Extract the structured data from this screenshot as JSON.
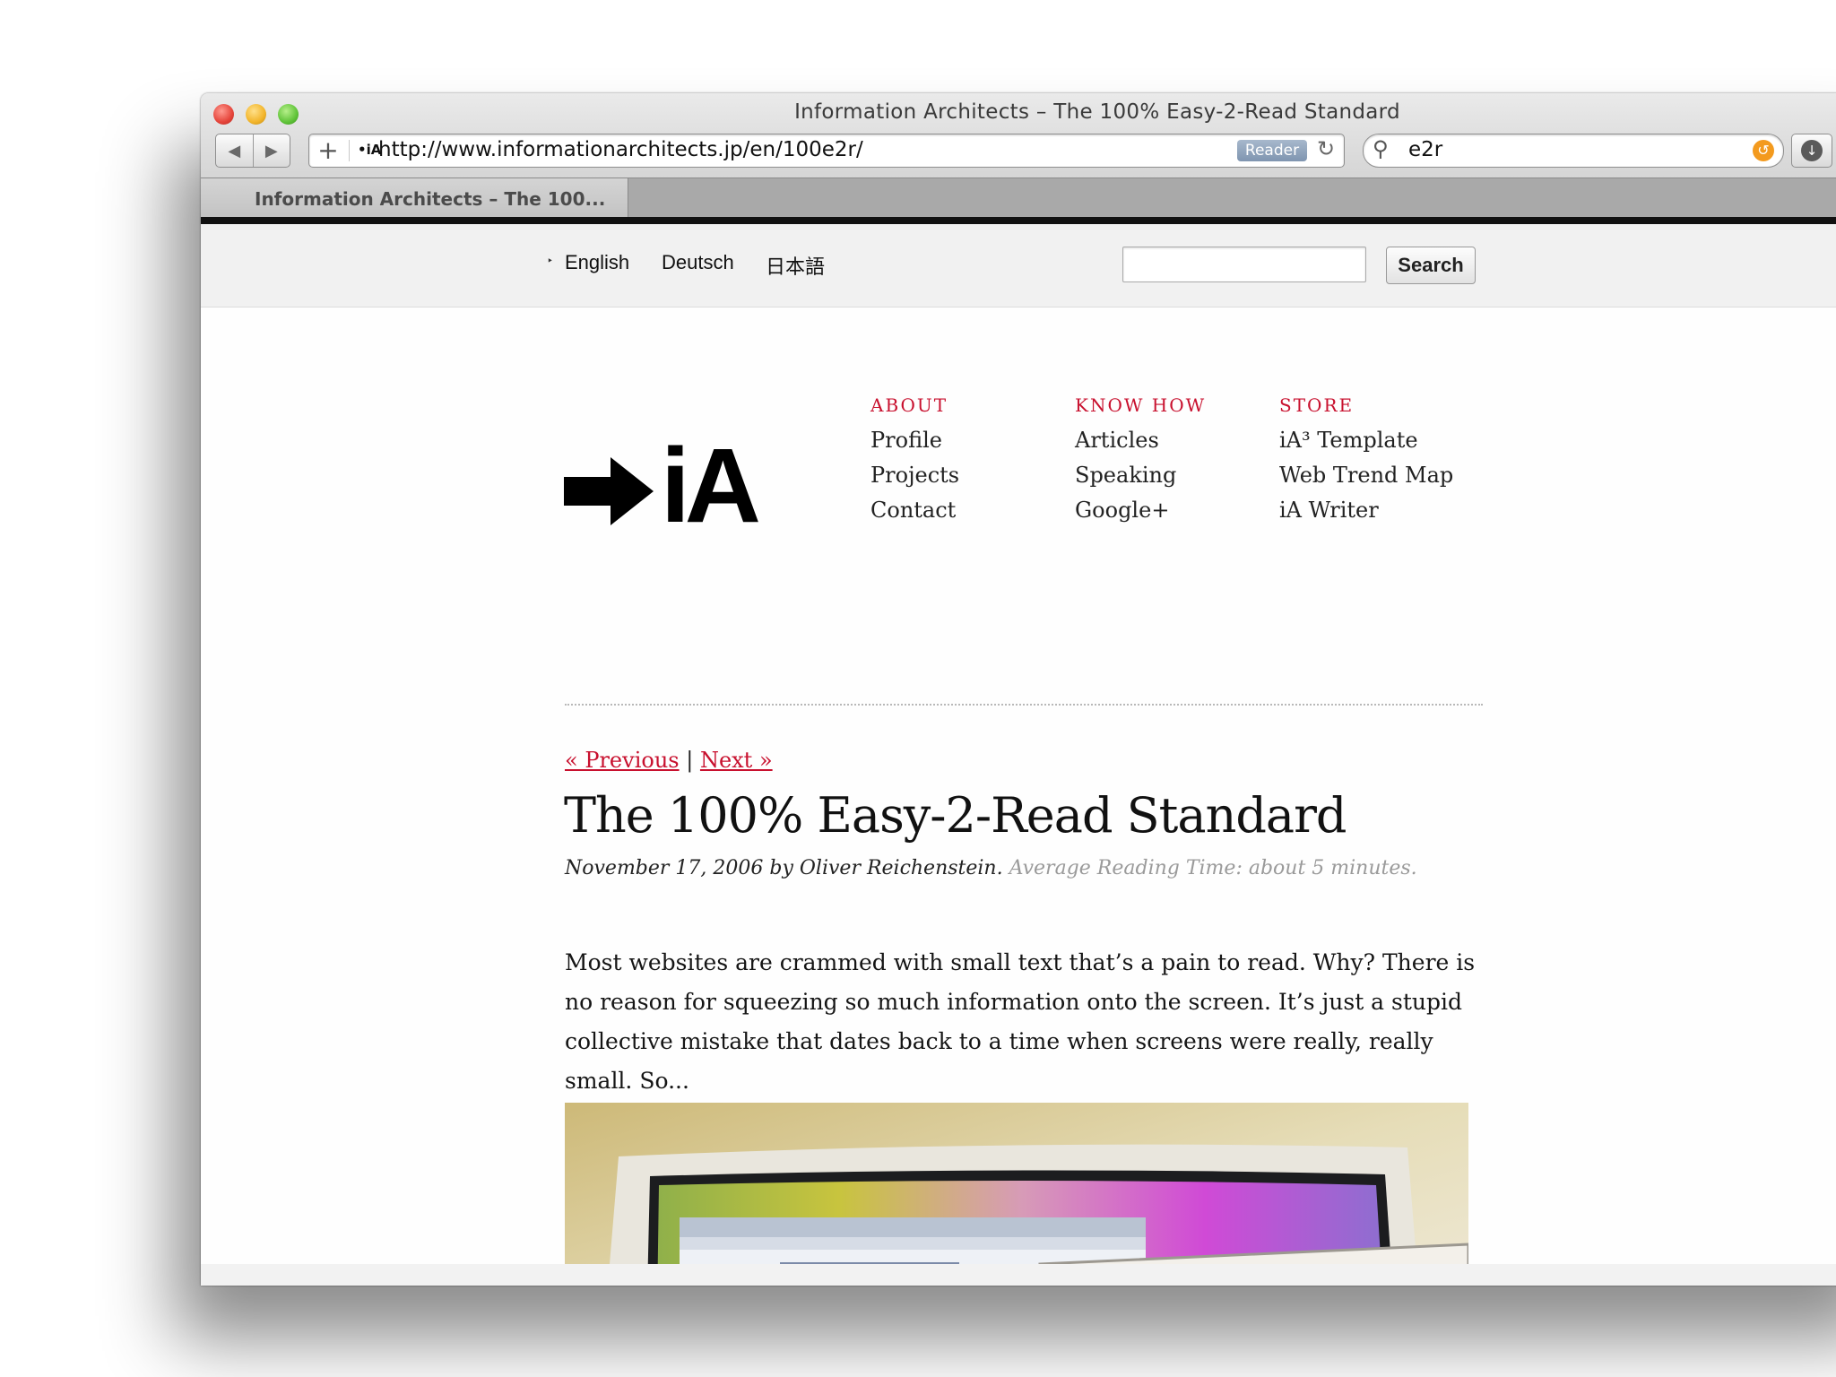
{
  "window": {
    "title": "Information Architects – The 100% Easy-2-Read Standard"
  },
  "toolbar": {
    "back_glyph": "◀",
    "forward_glyph": "▶",
    "add_glyph": "+",
    "favicon_text": "•iA",
    "url": "http://www.informationarchitects.jp/en/100e2r/",
    "reader_label": "Reader",
    "reload_glyph": "↻",
    "search_glyph": "⚲",
    "search_value": "e2r",
    "clear_glyph": "↺",
    "download_glyph": "↓"
  },
  "tabs": {
    "active_label": "Information Architects – The 100...",
    "new_tab_glyph": "+"
  },
  "site": {
    "languages": [
      "English",
      "Deutsch",
      "日本語"
    ],
    "lang_marker": "‣",
    "search_button": "Search",
    "logo_text": "iA",
    "nav": [
      {
        "heading": "ABOUT",
        "links": [
          "Profile",
          "Projects",
          "Contact"
        ]
      },
      {
        "heading": "KNOW HOW",
        "links": [
          "Articles",
          "Speaking",
          "Google+"
        ]
      },
      {
        "heading": "STORE",
        "links": [
          "iA³ Template",
          "Web Trend Map",
          "iA Writer"
        ]
      }
    ]
  },
  "article": {
    "previous": "« Previous",
    "separator": " | ",
    "next": "Next »",
    "title": "The 100% Easy-2-Read Standard",
    "byline": "November 17, 2006 by Oliver Reichenstein.",
    "reading_time": "Average Reading Time: about 5 minutes.",
    "intro": "Most websites are crammed with small text that’s a pain to read. Why? There is no reason for squeezing so much information onto the screen. It’s just a stupid collective mistake that dates back to a time when screens were really, really small. So..."
  },
  "colors": {
    "accent": "#c8102e",
    "reading_time": "#9a9a9a"
  }
}
